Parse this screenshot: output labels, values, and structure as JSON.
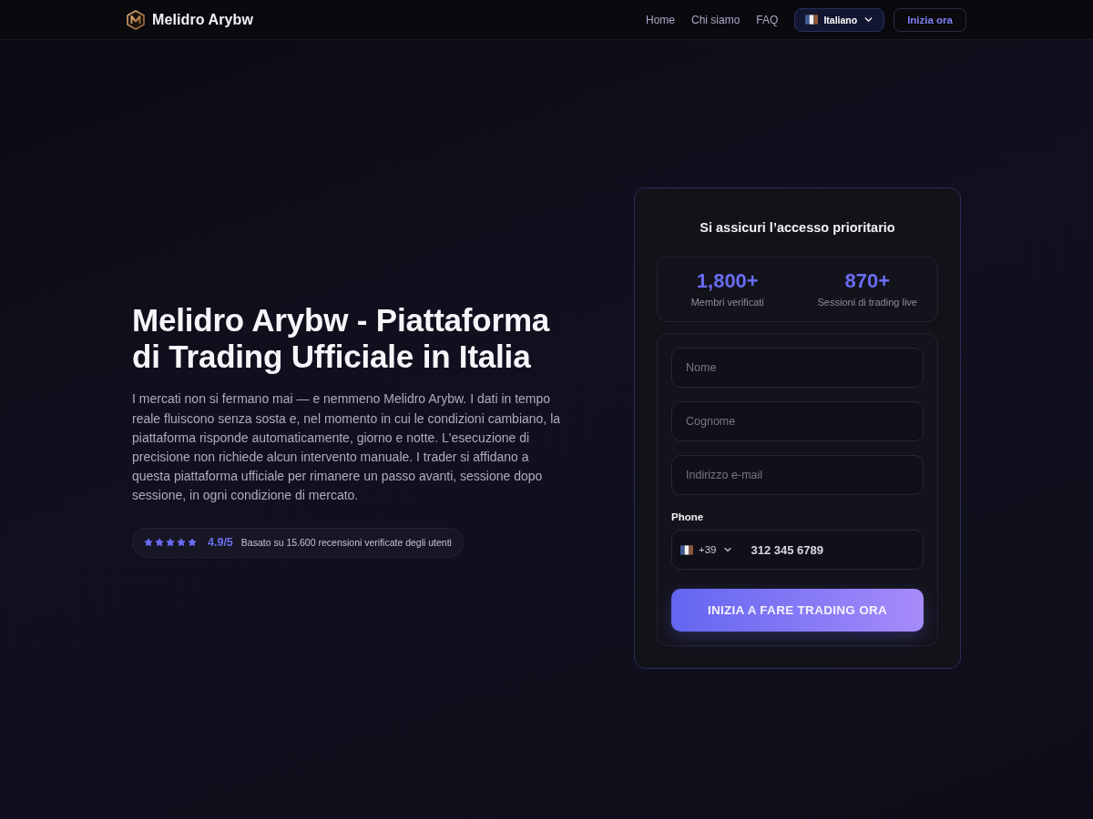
{
  "header": {
    "brand": "Melidro Arybw",
    "nav": [
      {
        "label": "Home"
      },
      {
        "label": "Chi siamo"
      },
      {
        "label": "FAQ"
      }
    ],
    "language": {
      "label": "Italiano"
    },
    "cta": "Inizia ora"
  },
  "hero": {
    "title": "Melidro Arybw - Piattaforma di Trading Ufficiale in Italia",
    "description": "I mercati non si fermano mai — e nemmeno Melidro Arybw. I dati in tempo reale fluiscono senza sosta e, nel momento in cui le condizioni cambiano, la piattaforma risponde automaticamente, giorno e notte. L'esecuzione di precisione non richiede alcun intervento manuale. I trader si affidano a questa piattaforma ufficiale per rimanere un passo avanti, sessione dopo sessione, in ogni condizione di mercato.",
    "rating": {
      "stars": 5,
      "score": "4.9/5",
      "text": "Basato su 15.600 recensioni verificate degli utenti"
    }
  },
  "signup": {
    "title": "Si assicuri l’accesso prioritario",
    "stats": [
      {
        "value": "1,800+",
        "label": "Membri verificati"
      },
      {
        "value": "870+",
        "label": "Sessioni di trading live"
      }
    ],
    "fields": [
      {
        "placeholder": "Nome"
      },
      {
        "placeholder": "Cognome"
      },
      {
        "placeholder": "Indirizzo e-mail"
      }
    ],
    "phone": {
      "label": "Phone",
      "code": "+39",
      "value": "312 345 6789"
    },
    "submit": "INIZIA A FARE TRADING ORA"
  }
}
